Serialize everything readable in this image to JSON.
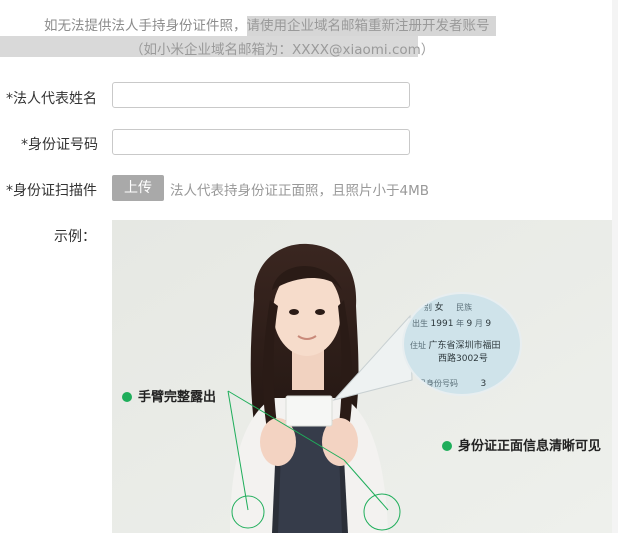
{
  "notice": {
    "line1_plain": "如无法提供法人手持身份证件照，",
    "line1_highlight": "请使用企业域名邮箱重新注册开发者账号",
    "line2": "（如小米企业域名邮箱为：XXXX@xiaomi.com）"
  },
  "form": {
    "name_label": "*法人代表姓名",
    "id_label": "*身份证号码",
    "scan_label": "*身份证扫描件",
    "upload_button": "上传",
    "upload_hint": "法人代表持身份证正面照，且照片小于4MB",
    "example_label": "示例："
  },
  "example_image": {
    "caption_arm": "手臂完整露出",
    "caption_id": "身份证正面信息清晰可见",
    "card_sex_label": "别",
    "card_sex": "女",
    "card_ethnic_label": "民族",
    "card_birth_label": "出生",
    "card_birth_year": "1991",
    "card_month_label": "年",
    "card_month": "9",
    "card_day_label": "月",
    "card_day": "9",
    "card_addr_label": "住址",
    "card_addr_1": "广东省深圳市福田",
    "card_addr_2": "西路3002号",
    "card_idno_label": "公民身份号码",
    "card_idno": "3"
  },
  "colors": {
    "accent_green": "#1fae5b",
    "upload_button_bg": "#a9a9a9",
    "notice_highlight": "#d6d6d6"
  }
}
